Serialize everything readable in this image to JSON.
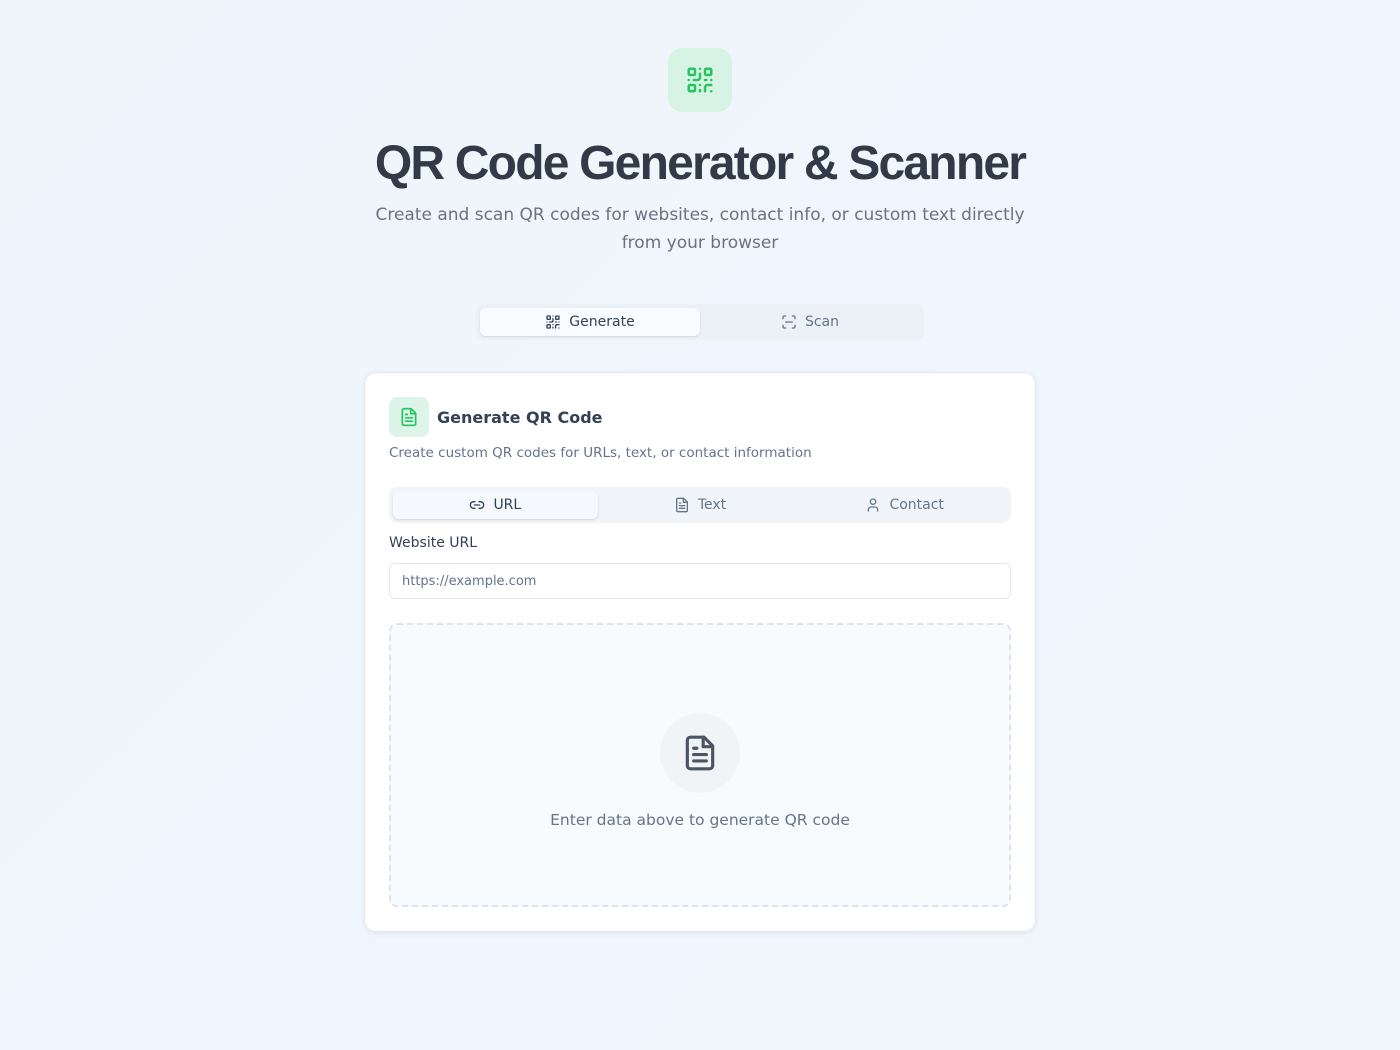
{
  "header": {
    "icon": "qr-code-icon",
    "title": "QR Code Generator & Scanner",
    "subtitle": "Create and scan QR codes for websites, contact info, or custom text directly from your browser"
  },
  "mode_tabs": [
    {
      "label": "Generate",
      "icon": "qr-code-icon",
      "active": true
    },
    {
      "label": "Scan",
      "icon": "scan-icon",
      "active": false
    }
  ],
  "card": {
    "icon": "document-icon",
    "title": "Generate QR Code",
    "description": "Create custom QR codes for URLs, text, or contact information",
    "type_tabs": [
      {
        "label": "URL",
        "icon": "link-icon",
        "active": true
      },
      {
        "label": "Text",
        "icon": "document-icon",
        "active": false
      },
      {
        "label": "Contact",
        "icon": "user-icon",
        "active": false
      }
    ],
    "field_label": "Website URL",
    "input_placeholder": "https://example.com",
    "input_value": "",
    "preview_icon": "document-icon",
    "preview_text": "Enter data above to generate QR code"
  },
  "colors": {
    "accent_green": "#22c55e",
    "icon_bg_green": "#d7f3e4",
    "text_dark": "#323a47",
    "text_muted": "#64748b"
  }
}
